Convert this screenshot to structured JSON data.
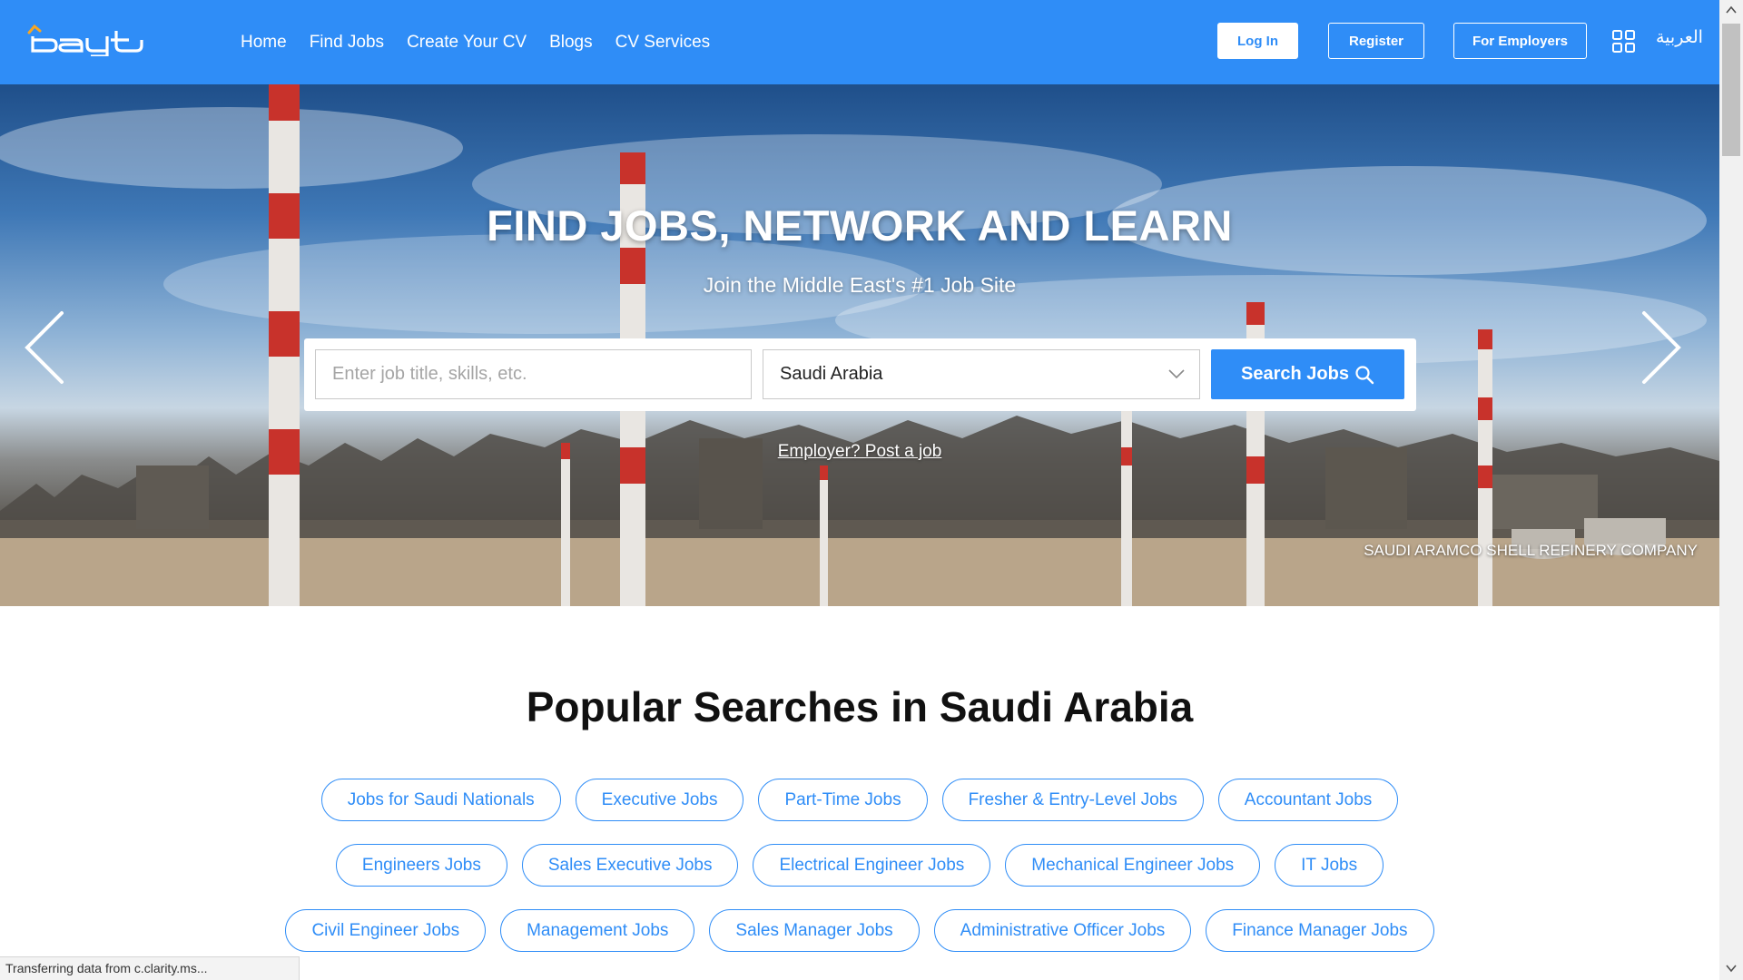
{
  "header": {
    "logo_alt": "bayt",
    "nav": [
      "Home",
      "Find Jobs",
      "Create Your CV",
      "Blogs",
      "CV Services"
    ],
    "login_label": "Log In",
    "register_label": "Register",
    "employers_label": "For Employers",
    "language_label": "العربية",
    "colors": {
      "brand": "#2f8df7",
      "logo_accent": "#f7a623"
    }
  },
  "hero": {
    "title": "FIND JOBS, NETWORK AND LEARN",
    "subtitle": "Join the Middle East's #1 Job Site",
    "search_placeholder": "Enter job title, skills, etc.",
    "search_value": "",
    "country_selected": "Saudi Arabia",
    "search_button_label": "Search Jobs",
    "employer_link": "Employer? Post a job",
    "caption": "SAUDI ARAMCO SHELL REFINERY COMPANY"
  },
  "popular": {
    "title": "Popular Searches in Saudi Arabia",
    "rows": [
      [
        "Jobs for Saudi Nationals",
        "Executive Jobs",
        "Part-Time Jobs",
        "Fresher & Entry-Level Jobs",
        "Accountant Jobs"
      ],
      [
        "Engineers Jobs",
        "Sales Executive Jobs",
        "Electrical Engineer Jobs",
        "Mechanical Engineer Jobs",
        "IT Jobs"
      ],
      [
        "Civil Engineer Jobs",
        "Management Jobs",
        "Sales Manager Jobs",
        "Administrative Officer Jobs",
        "Finance Manager Jobs"
      ]
    ]
  },
  "status_bar": "Transferring data from c.clarity.ms..."
}
